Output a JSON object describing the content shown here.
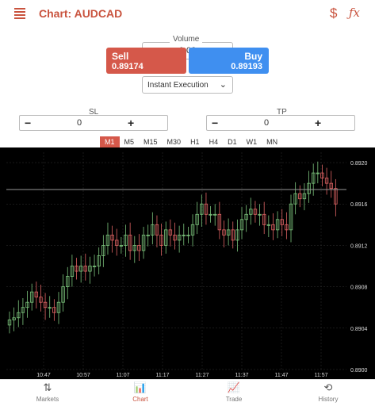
{
  "header": {
    "title": "Chart: AUDCAD",
    "dollar_icon": "dollar-icon",
    "fx_icon": "function-icon",
    "dollar_glyph": "$",
    "fx_glyph": "ƒx"
  },
  "volume": {
    "label": "Volume",
    "value": "0.02"
  },
  "sell": {
    "label": "Sell",
    "price": "0.89174",
    "color": "#d5584a"
  },
  "buy": {
    "label": "Buy",
    "price": "0.89193",
    "color": "#3f8ff0"
  },
  "execution": {
    "value": "Instant Execution"
  },
  "sl": {
    "label": "SL",
    "value": "0"
  },
  "tp": {
    "label": "TP",
    "value": "0"
  },
  "timeframes": [
    "M1",
    "M5",
    "M15",
    "M30",
    "H1",
    "H4",
    "D1",
    "W1",
    "MN"
  ],
  "active_timeframe": "M1",
  "chart_data": {
    "type": "candlestick",
    "symbol": "AUDCAD",
    "y_ticks": [
      "0.8920",
      "0.8916",
      "0.8912",
      "0.8908",
      "0.8904",
      "0.8900"
    ],
    "x_ticks": [
      "10:47",
      "10:57",
      "11:07",
      "11:17",
      "11:27",
      "11:37",
      "11:47",
      "11:57"
    ],
    "ylim": [
      0.89,
      0.8921
    ],
    "current_price": 0.89174,
    "closes": [
      0.89048,
      0.8905,
      0.89055,
      0.8906,
      0.89065,
      0.89075,
      0.8907,
      0.89065,
      0.8906,
      0.8906,
      0.89055,
      0.89065,
      0.8908,
      0.8909,
      0.891,
      0.89095,
      0.891,
      0.89095,
      0.891,
      0.891,
      0.8911,
      0.8912,
      0.8913,
      0.89125,
      0.8912,
      0.8912,
      0.8913,
      0.89115,
      0.8912,
      0.89115,
      0.8913,
      0.8913,
      0.8914,
      0.8913,
      0.8912,
      0.89135,
      0.8913,
      0.89125,
      0.8913,
      0.8913,
      0.8913,
      0.8914,
      0.8915,
      0.8916,
      0.8915,
      0.8915,
      0.8915,
      0.89135,
      0.8913,
      0.89135,
      0.89125,
      0.89135,
      0.89145,
      0.8915,
      0.89155,
      0.8915,
      0.8915,
      0.8914,
      0.8914,
      0.89135,
      0.89145,
      0.8914,
      0.89135,
      0.8916,
      0.8917,
      0.89165,
      0.8917,
      0.8918,
      0.8919,
      0.8919,
      0.89185,
      0.8918,
      0.89175,
      0.8916
    ]
  },
  "nav": [
    {
      "label": "Markets",
      "icon": "sort-arrows-icon",
      "glyph": "⇅"
    },
    {
      "label": "Chart",
      "icon": "candlestick-icon",
      "glyph": "📊"
    },
    {
      "label": "Trade",
      "icon": "trend-line-icon",
      "glyph": "📈"
    },
    {
      "label": "History",
      "icon": "history-icon",
      "glyph": "⟲"
    }
  ],
  "active_nav": "Chart"
}
